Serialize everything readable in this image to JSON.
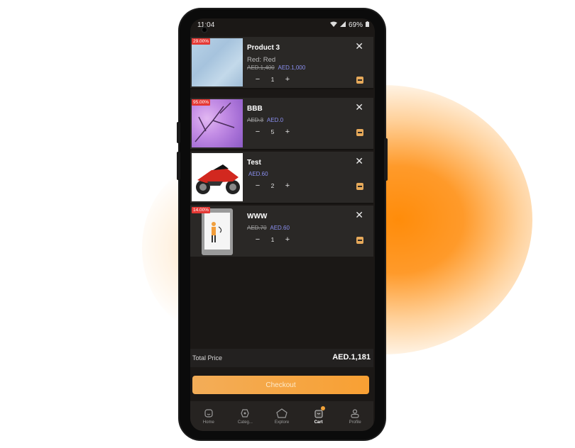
{
  "status": {
    "time": "11:04",
    "battery": "69%"
  },
  "cart": {
    "items": [
      {
        "badge": "29.00%",
        "title": "Product 3",
        "variant": "Red: Red",
        "old_price": "AED.1,400",
        "price": "AED.1,000",
        "qty": "1"
      },
      {
        "badge": "95.00%",
        "title": "BBB",
        "variant": "",
        "old_price": "AED.3",
        "price": "AED.0",
        "qty": "5"
      },
      {
        "badge": "",
        "title": "Test",
        "variant": "",
        "old_price": "",
        "price": "AED.60",
        "qty": "2"
      },
      {
        "badge": "14.00%",
        "title": "WWW",
        "variant": "",
        "old_price": "AED.70",
        "price": "AED.60",
        "qty": "1"
      }
    ],
    "minus": "−",
    "plus": "+",
    "close": "✕"
  },
  "total": {
    "label": "Total Price",
    "amount": "AED.1,181"
  },
  "checkout_label": "Checkout",
  "nav": [
    {
      "label": "Home",
      "icon": "home-icon"
    },
    {
      "label": "Categ...",
      "icon": "categories-icon"
    },
    {
      "label": "Explore",
      "icon": "explore-icon"
    },
    {
      "label": "Cart",
      "icon": "cart-icon"
    },
    {
      "label": "Profile",
      "icon": "profile-icon"
    }
  ],
  "colors": {
    "accent": "#f8a033",
    "price": "#8a8ff0",
    "badge": "#e53935",
    "background": "#1b1816"
  }
}
